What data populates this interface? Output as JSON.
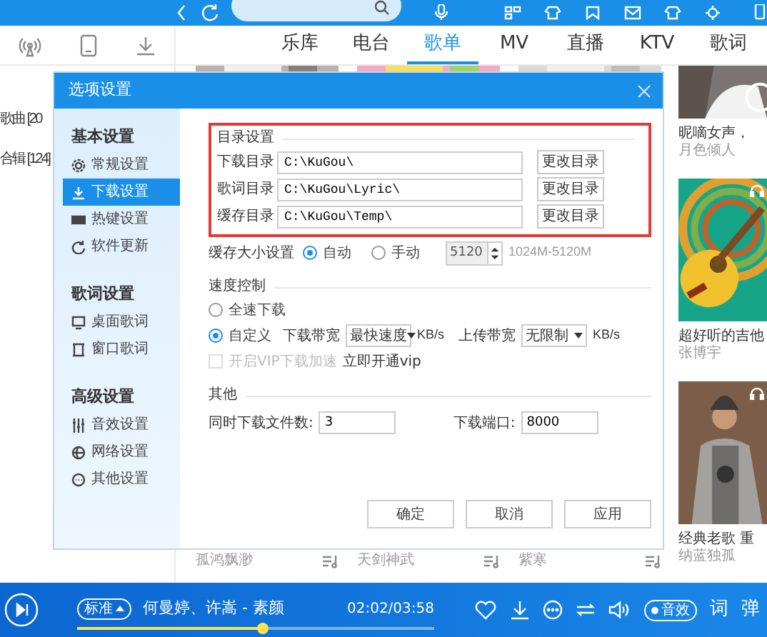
{
  "nav": {
    "tabs": [
      {
        "label": "乐库",
        "selected": false
      },
      {
        "label": "电台",
        "selected": false
      },
      {
        "label": "歌单",
        "selected": true
      },
      {
        "label": "MV",
        "selected": false
      },
      {
        "label": "直播",
        "selected": false
      },
      {
        "label": "KTV",
        "selected": false
      },
      {
        "label": "歌词",
        "selected": false
      }
    ]
  },
  "library": {
    "items": [
      "歌曲 [20",
      "合辑 [124]"
    ]
  },
  "cards_bottom": [
    {
      "author": "孤鸿飘渺"
    },
    {
      "author": "天剑神武"
    },
    {
      "author": "紫寒"
    }
  ],
  "side_cards": [
    {
      "title": "昵嘀女声，",
      "author": "月色倾人"
    },
    {
      "title": "超好听的吉他",
      "author": "张博宇"
    },
    {
      "title": "经典老歌 重",
      "author": "纳蓝独孤"
    }
  ],
  "dialog": {
    "title": "选项设置",
    "sidebar": [
      {
        "heading": "基本设置",
        "items": [
          {
            "label": "常规设置",
            "selected": false
          },
          {
            "label": "下载设置",
            "selected": true
          },
          {
            "label": "热键设置",
            "selected": false
          },
          {
            "label": "软件更新",
            "selected": false
          }
        ]
      },
      {
        "heading": "歌词设置",
        "items": [
          {
            "label": "桌面歌词",
            "selected": false
          },
          {
            "label": "窗口歌词",
            "selected": false
          }
        ]
      },
      {
        "heading": "高级设置",
        "items": [
          {
            "label": "音效设置",
            "selected": false
          },
          {
            "label": "网络设置",
            "selected": false
          },
          {
            "label": "其他设置",
            "selected": false
          }
        ]
      }
    ],
    "directory": {
      "heading": "目录设置",
      "rows": [
        {
          "label": "下载目录",
          "value": "C:\\KuGou\\",
          "button": "更改目录"
        },
        {
          "label": "歌词目录",
          "value": "C:\\KuGou\\Lyric\\",
          "button": "更改目录"
        },
        {
          "label": "缓存目录",
          "value": "C:\\KuGou\\Temp\\",
          "button": "更改目录"
        }
      ]
    },
    "cache": {
      "label": "缓存大小设置",
      "options": [
        {
          "label": "自动",
          "selected": true
        },
        {
          "label": "手动",
          "selected": false
        }
      ],
      "size": "5120",
      "range": "1024M-5120M"
    },
    "speed": {
      "heading": "速度控制",
      "options": [
        {
          "label": "全速下载",
          "selected": false
        },
        {
          "label": "自定义",
          "selected": true
        }
      ],
      "download_label": "下载带宽",
      "download_value": "最快速度",
      "download_unit": "KB/s",
      "upload_label": "上传带宽",
      "upload_value": "无限制",
      "upload_unit": "KB/s",
      "vip": {
        "label": "开启VIP下载加速",
        "checked": false,
        "disabled": true
      },
      "vip_link": "立即开通vip"
    },
    "other": {
      "heading": "其他",
      "files_label": "同时下载文件数:",
      "files_value": "3",
      "port_label": "下载端口:",
      "port_value": "8000"
    },
    "buttons": [
      "确定",
      "取消",
      "应用"
    ]
  },
  "player": {
    "quality": "标准",
    "song": "何曼婷、许嵩 - 素颜",
    "time": "02:02/03:58",
    "level": 0.52,
    "effect": "音效",
    "lyrics_button": "词",
    "danmaku_button": "弹"
  }
}
